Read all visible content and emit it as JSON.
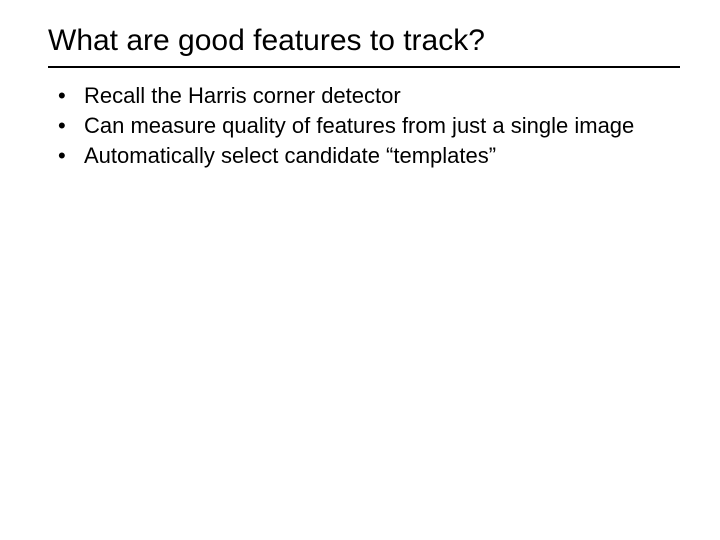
{
  "title": "What are good features to track?",
  "bullets": [
    "Recall the Harris corner detector",
    "Can measure quality of features from just a single image",
    "Automatically select candidate “templates”"
  ]
}
